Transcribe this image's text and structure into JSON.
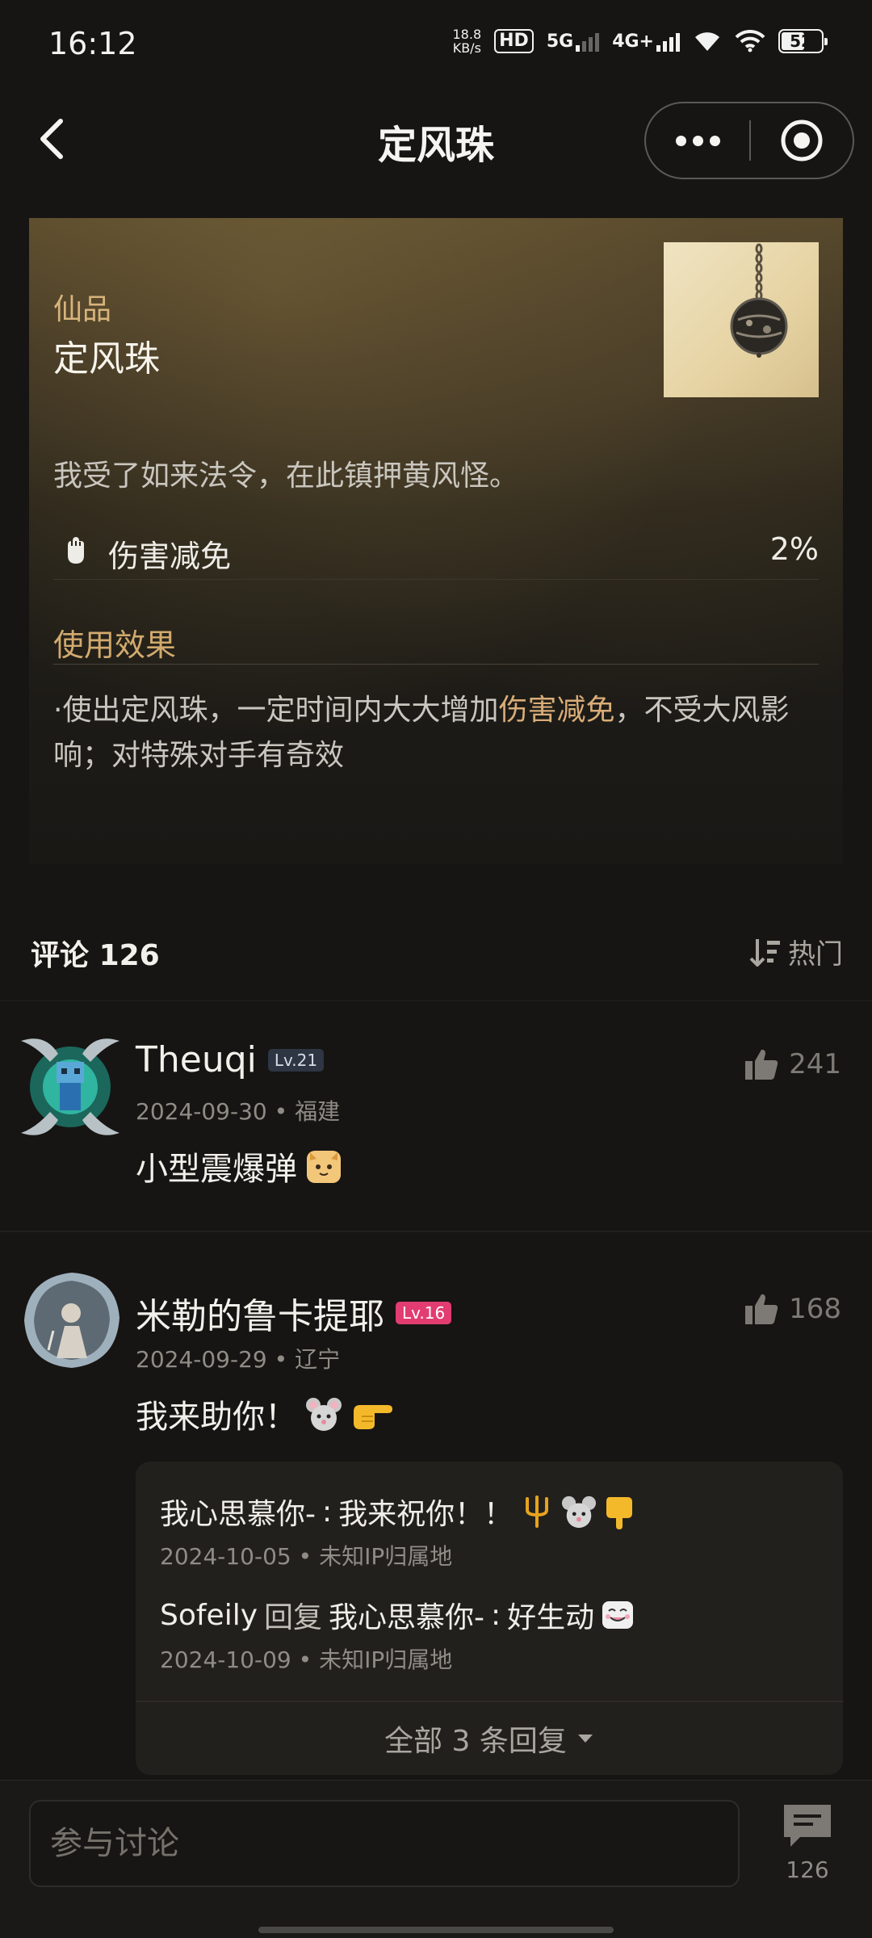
{
  "status_bar": {
    "time": "16:12",
    "net_speed_value": "18.8",
    "net_speed_unit": "KB/s",
    "hd": "HD",
    "net1": "5G",
    "net2": "4G+",
    "battery": "52"
  },
  "nav": {
    "title": "定风珠"
  },
  "item": {
    "grade": "仙品",
    "name": "定风珠",
    "description": "我受了如来法令，在此镇押黄风怪。",
    "stat_label": "伤害减免",
    "stat_value": "2%",
    "effect_title": "使用效果",
    "effect_prefix": "·使出定风珠，一定时间内大大增加",
    "effect_highlight": "伤害减免",
    "effect_suffix": "，不受大风影响；对特殊对手有奇效"
  },
  "comments_header": {
    "title": "评论",
    "count": "126",
    "sort_label": "热门"
  },
  "comments": [
    {
      "name": "Theuqi",
      "level": "Lv.21",
      "date": "2024-09-30",
      "location": "福建",
      "text": "小型震爆弹",
      "likes": "241"
    },
    {
      "name": "米勒的鲁卡提耶",
      "level": "Lv.16",
      "date": "2024-09-29",
      "location": "辽宁",
      "text": "我来助你！",
      "likes": "168",
      "replies": [
        {
          "author": "我心思慕你-",
          "reply_to": "",
          "text": "我来祝你！！",
          "date": "2024-10-05",
          "location": "未知IP归属地"
        },
        {
          "author": "Sofeily",
          "reply_word": "回复",
          "reply_to": "我心思慕你-",
          "text": "好生动",
          "date": "2024-10-09",
          "location": "未知IP归属地"
        }
      ],
      "more_replies_label": "全部 3 条回复"
    }
  ],
  "bottom_bar": {
    "placeholder": "参与讨论",
    "comment_count": "126"
  },
  "meta_separator": "•",
  "colon": ": "
}
